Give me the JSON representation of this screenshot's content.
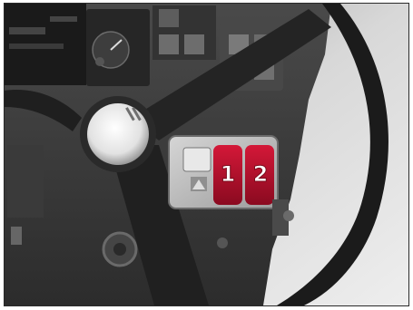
{
  "photo": {
    "subject": "vehicle-cockpit-steering-wheel",
    "colors": {
      "dash": "#3b3b3b",
      "dash_light": "#5a5a5a",
      "wheel": "#1e1e1e",
      "hub": "#ebebeb",
      "switch_panel": "#bdbdbd",
      "accent": "#b0102a",
      "background_right": "#d9d9d9"
    }
  },
  "switch_labels": {
    "one": "1",
    "two": "2"
  }
}
